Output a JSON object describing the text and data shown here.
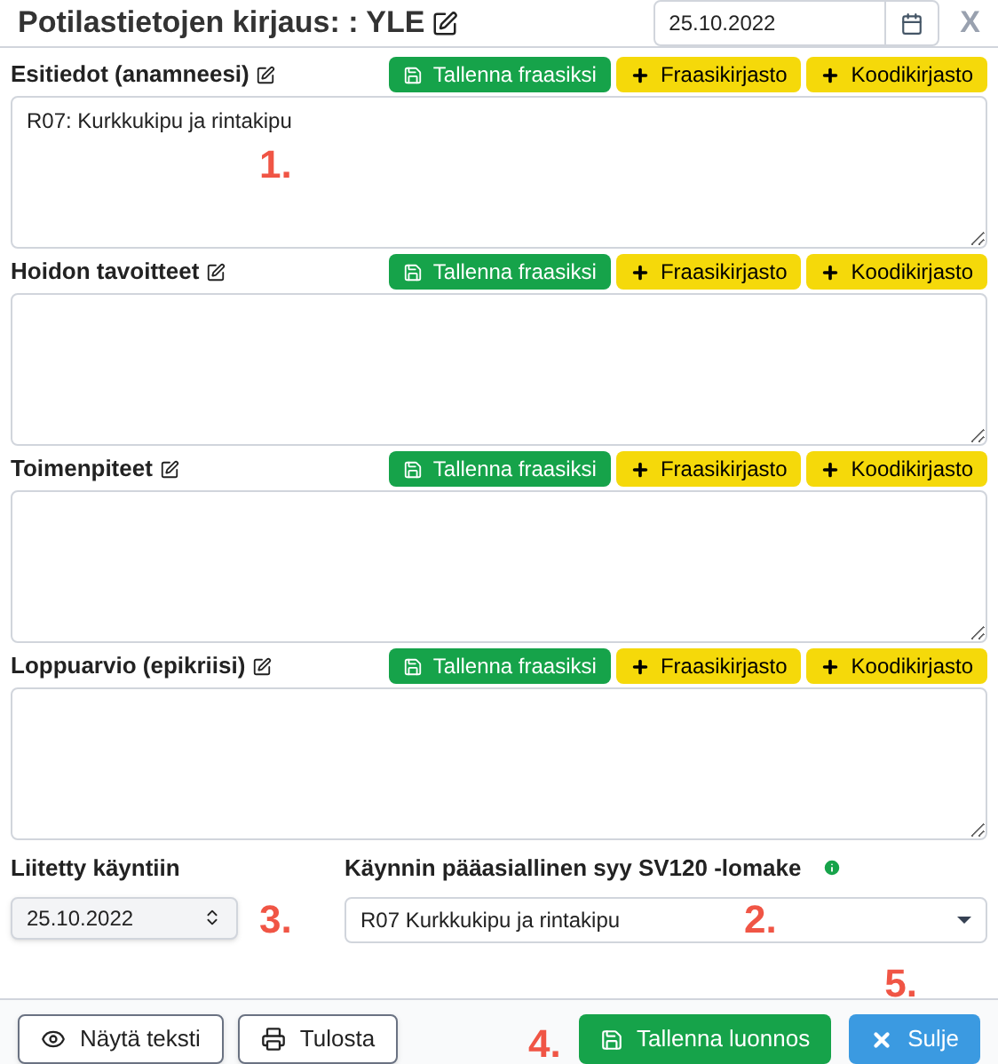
{
  "header": {
    "title": "Potilastietojen kirjaus: : YLE",
    "date": "25.10.2022",
    "close": "X"
  },
  "sections": [
    {
      "label": "Esitiedot (anamneesi)",
      "value": "R07: Kurkkukipu ja rintakipu",
      "annotation": "1.",
      "buttons": [
        {
          "kind": "save",
          "label": "Tallenna fraasiksi"
        },
        {
          "kind": "add",
          "label": "Fraasikirjasto"
        },
        {
          "kind": "add",
          "label": "Koodikirjasto"
        }
      ]
    },
    {
      "label": "Hoidon tavoitteet",
      "buttons": [
        {
          "kind": "save",
          "label": "Tallenna fraasiksi"
        },
        {
          "kind": "add",
          "label": "Fraasikirjasto"
        },
        {
          "kind": "add",
          "label": "Koodikirjasto"
        }
      ]
    },
    {
      "label": "Toimenpiteet",
      "buttons": [
        {
          "kind": "save",
          "label": "Tallenna fraasiksi"
        },
        {
          "kind": "add",
          "label": "Fraasikirjasto"
        },
        {
          "kind": "add",
          "label": "Koodikirjasto"
        }
      ]
    },
    {
      "label": "Loppuarvio (epikriisi)",
      "buttons": [
        {
          "kind": "save",
          "label": "Tallenna fraasiksi"
        },
        {
          "kind": "add",
          "label": "Fraasikirjasto"
        },
        {
          "kind": "add",
          "label": "Koodikirjasto"
        }
      ]
    }
  ],
  "visit": {
    "label": "Liitetty käyntiin",
    "value": "25.10.2022",
    "annotation": "3."
  },
  "reason": {
    "label": "Käynnin pääasiallinen syy SV120 -lomake",
    "value": "R07 Kurkkukipu ja rintakipu",
    "annotation": "2."
  },
  "footer": {
    "left": [
      {
        "kind": "view",
        "label": "Näytä teksti"
      },
      {
        "kind": "print",
        "label": "Tulosta"
      }
    ],
    "right": [
      {
        "kind": "save",
        "label": "Tallenna luonnos",
        "annotation": "4."
      },
      {
        "kind": "close",
        "label": "Sulje",
        "annotation": "5."
      }
    ]
  }
}
